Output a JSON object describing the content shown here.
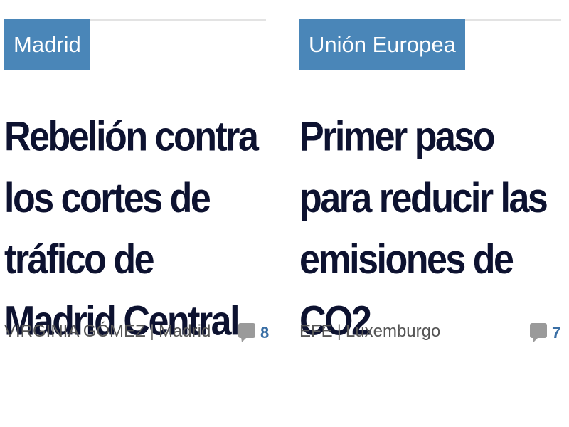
{
  "articles": [
    {
      "section": "Madrid",
      "headline": "Rebelión contra los cortes de tráfico de Madrid Central",
      "author": "VIRGINIA GÓMEZ",
      "separator": "|",
      "location": "Madrid",
      "comment_count": "8",
      "comment_icon": "comment-bubble-icon"
    },
    {
      "section": "Unión Europea",
      "headline": "Primer paso para reducir las emisiones de CO2",
      "author": "EFE",
      "separator": "|",
      "location": "Luxemburgo",
      "comment_count": "7",
      "comment_icon": "comment-bubble-icon"
    }
  ],
  "colors": {
    "section_tag_bg": "#4a86b8",
    "section_tag_text": "#ffffff",
    "headline": "#0d1230",
    "byline": "#555555",
    "comment_count": "#3a6fa5",
    "comment_icon": "#9a9a9a",
    "rule": "#e3e3e3"
  }
}
